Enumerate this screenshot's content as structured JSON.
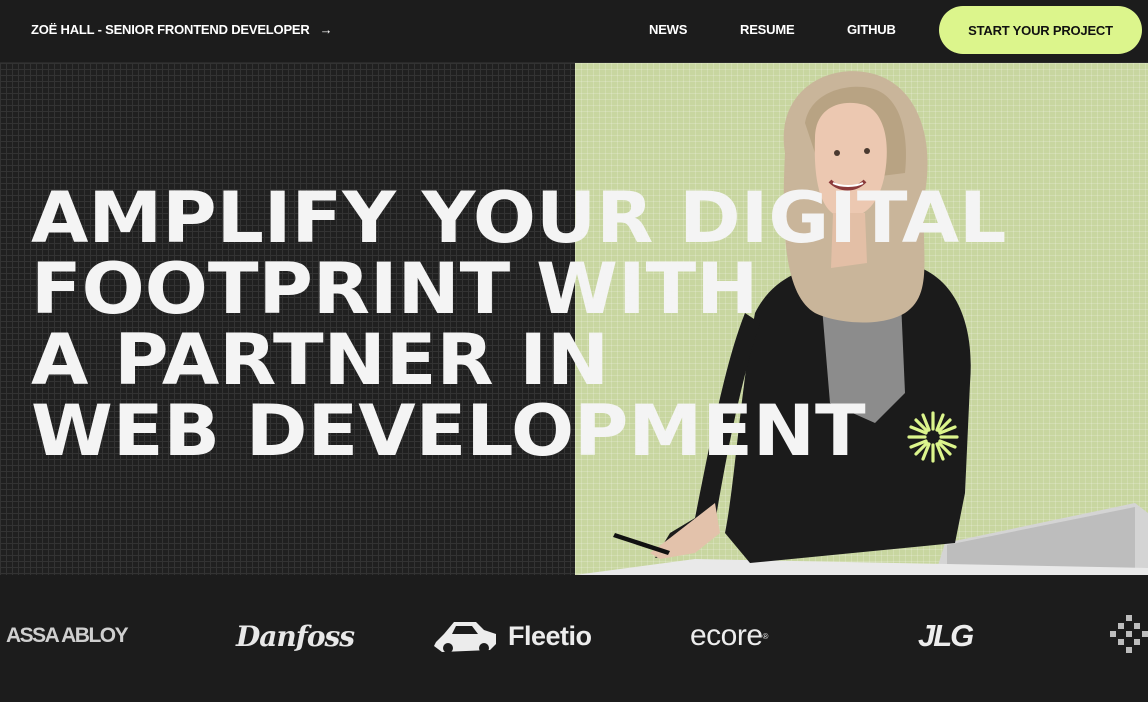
{
  "header": {
    "brand_label": "ZOË HALL - SENIOR FRONTEND DEVELOPER",
    "brand_arrow": "→",
    "nav": [
      {
        "label": "NEWS"
      },
      {
        "label": "RESUME"
      },
      {
        "label": "GITHUB"
      }
    ],
    "cta_label": "START YOUR PROJECT"
  },
  "hero": {
    "headline_lines": [
      "AMPLIFY YOUR DIGITAL",
      "FOOTPRINT WITH",
      "A PARTNER IN",
      "WEB DEVELOPMENT"
    ]
  },
  "logos": [
    {
      "name": "ASSA ABLOY"
    },
    {
      "name": "Danfoss"
    },
    {
      "name": "Fleetio"
    },
    {
      "name": "ecore"
    },
    {
      "name": "JLG"
    }
  ],
  "colors": {
    "accent": "#dcf58c",
    "hero_right_bg": "#c8d6a0",
    "page_bg": "#1c1c1c"
  }
}
